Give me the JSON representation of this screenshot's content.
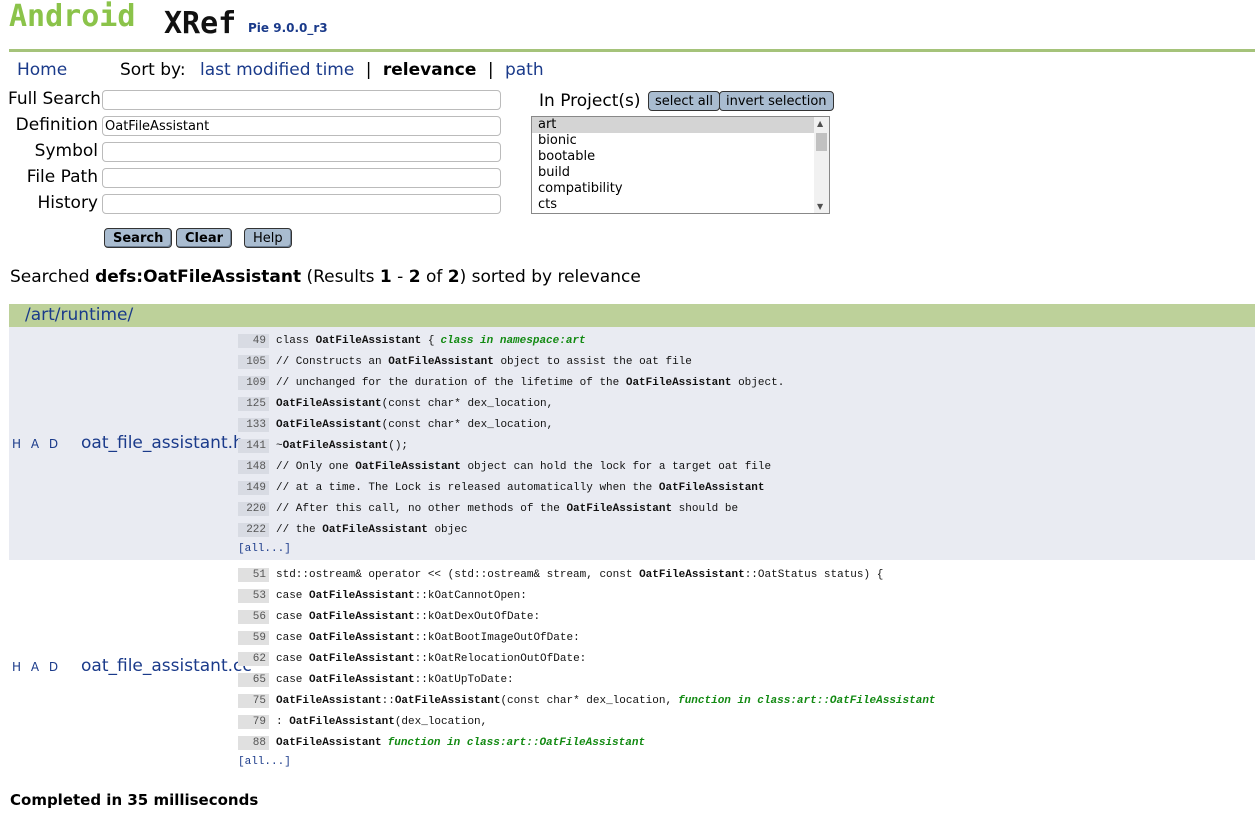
{
  "logo": {
    "android": "Android",
    "xref": "XRef",
    "version": "Pie 9.0.0_r3"
  },
  "nav": {
    "home": "Home",
    "sort_label": "Sort by:",
    "sort_options": [
      "last modified time",
      "relevance",
      "path"
    ],
    "sort_separator": "|"
  },
  "form": {
    "fields": [
      {
        "label": "Full Search",
        "value": ""
      },
      {
        "label": "Definition",
        "value": "OatFileAssistant"
      },
      {
        "label": "Symbol",
        "value": ""
      },
      {
        "label": "File Path",
        "value": ""
      },
      {
        "label": "History",
        "value": ""
      }
    ],
    "buttons": {
      "search": "Search",
      "clear": "Clear",
      "help": "Help"
    },
    "projects_label": "In Project(s)",
    "select_all": "select all",
    "invert_selection": "invert selection",
    "projects": [
      "art",
      "bionic",
      "bootable",
      "build",
      "compatibility",
      "cts"
    ],
    "selected_project": "art"
  },
  "summary": {
    "prefix": "Searched ",
    "query": "defs:OatFileAssistant",
    "results_open": " (Results ",
    "from": "1",
    "dash": " - ",
    "to": "2",
    "of": " of ",
    "total": "2",
    "suffix": ") sorted by relevance"
  },
  "results": {
    "directory": "/art/runtime/",
    "files": [
      {
        "had": "H A D",
        "name": "oat_file_assistant.h",
        "lines": [
          {
            "num": "49",
            "parts": [
              [
                "class ",
                false
              ],
              [
                "OatFileAssistant",
                true
              ],
              [
                " {",
                false
              ]
            ],
            "annotation": "class in namespace:art"
          },
          {
            "num": "105",
            "parts": [
              [
                "// Constructs an ",
                false
              ],
              [
                "OatFileAssistant",
                true
              ],
              [
                " object to assist the oat file",
                false
              ]
            ]
          },
          {
            "num": "109",
            "parts": [
              [
                "// unchanged for the duration of the lifetime of the ",
                false
              ],
              [
                "OatFileAssistant",
                true
              ],
              [
                " object.",
                false
              ]
            ]
          },
          {
            "num": "125",
            "parts": [
              [
                "OatFileAssistant",
                true
              ],
              [
                "(const char* dex_location,",
                false
              ]
            ]
          },
          {
            "num": "133",
            "parts": [
              [
                "OatFileAssistant",
                true
              ],
              [
                "(const char* dex_location,",
                false
              ]
            ]
          },
          {
            "num": "141",
            "parts": [
              [
                "~",
                false
              ],
              [
                "OatFileAssistant",
                true
              ],
              [
                "();",
                false
              ]
            ]
          },
          {
            "num": "148",
            "parts": [
              [
                "// Only one ",
                false
              ],
              [
                "OatFileAssistant",
                true
              ],
              [
                " object can hold the lock for a target oat file",
                false
              ]
            ]
          },
          {
            "num": "149",
            "parts": [
              [
                "// at a time. The Lock is released automatically when the ",
                false
              ],
              [
                "OatFileAssistant",
                true
              ]
            ]
          },
          {
            "num": "220",
            "parts": [
              [
                "// After this call, no other methods of the ",
                false
              ],
              [
                "OatFileAssistant",
                true
              ],
              [
                " should be",
                false
              ]
            ]
          },
          {
            "num": "222",
            "parts": [
              [
                "// the ",
                false
              ],
              [
                "OatFileAssistant",
                true
              ],
              [
                " objec",
                false
              ]
            ]
          }
        ],
        "all_link": "[all...]"
      },
      {
        "had": "H A D",
        "name": "oat_file_assistant.cc",
        "lines": [
          {
            "num": "51",
            "parts": [
              [
                "std::ostream& operator << (std::ostream& stream, const ",
                false
              ],
              [
                "OatFileAssistant",
                true
              ],
              [
                "::OatStatus status) {",
                false
              ]
            ]
          },
          {
            "num": "53",
            "parts": [
              [
                "case ",
                false
              ],
              [
                "OatFileAssistant",
                true
              ],
              [
                "::kOatCannotOpen:",
                false
              ]
            ]
          },
          {
            "num": "56",
            "parts": [
              [
                "case ",
                false
              ],
              [
                "OatFileAssistant",
                true
              ],
              [
                "::kOatDexOutOfDate:",
                false
              ]
            ]
          },
          {
            "num": "59",
            "parts": [
              [
                "case ",
                false
              ],
              [
                "OatFileAssistant",
                true
              ],
              [
                "::kOatBootImageOutOfDate:",
                false
              ]
            ]
          },
          {
            "num": "62",
            "parts": [
              [
                "case ",
                false
              ],
              [
                "OatFileAssistant",
                true
              ],
              [
                "::kOatRelocationOutOfDate:",
                false
              ]
            ]
          },
          {
            "num": "65",
            "parts": [
              [
                "case ",
                false
              ],
              [
                "OatFileAssistant",
                true
              ],
              [
                "::kOatUpToDate:",
                false
              ]
            ]
          },
          {
            "num": "75",
            "parts": [
              [
                "OatFileAssistant",
                true
              ],
              [
                "::",
                false
              ],
              [
                "OatFileAssistant",
                true
              ],
              [
                "(const char* dex_location,",
                false
              ]
            ],
            "annotation": "function in class:art::OatFileAssistant"
          },
          {
            "num": "79",
            "parts": [
              [
                ": ",
                false
              ],
              [
                "OatFileAssistant",
                true
              ],
              [
                "(dex_location,",
                false
              ]
            ]
          },
          {
            "num": "88",
            "parts": [
              [
                "OatFileAssistant",
                true
              ]
            ],
            "annotation": "function in class:art::OatFileAssistant"
          }
        ],
        "all_link": "[all...]"
      }
    ]
  },
  "footer": {
    "completed": "Completed in 35 milliseconds"
  },
  "colors": {
    "accent_green": "#8bc34a",
    "header_bar": "#bdd19a",
    "link": "#1a3a8a",
    "annotation": "#138a13"
  }
}
